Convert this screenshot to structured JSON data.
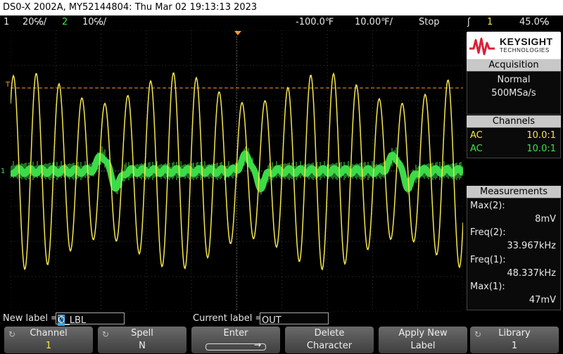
{
  "title": "DS0-X 2002A, MY52144804: Thu Mar 02 19:13:13 2023",
  "status": {
    "ch1_num": "1",
    "ch1_scale": "20℅/",
    "ch2_num": "2",
    "ch2_scale": "10℅/",
    "time_delay": "-100.0℉",
    "time_scale": "10.00℉/",
    "run_state": "Stop",
    "trigger_symbol": "ʃ",
    "trigger_source": "1",
    "trigger_level": "45.0℅"
  },
  "screen": {
    "trigger_marker": "T",
    "ground_marker": "1"
  },
  "colors": {
    "ch1": "#f5e64a",
    "ch2": "#3ee04a",
    "trigger": "#ff9a2a",
    "grid": "#3a3a3a",
    "logo_wave": "#d6223a"
  },
  "logo": {
    "brand": "KEYSIGHT",
    "sub": "TECHNOLOGIES"
  },
  "acquisition": {
    "header": "Acquisition",
    "mode": "Normal",
    "rate": "500MSa/s"
  },
  "channels": {
    "header": "Channels",
    "rows": [
      {
        "coupling": "AC",
        "probe": "10.0:1"
      },
      {
        "coupling": "AC",
        "probe": "10.0:1"
      }
    ]
  },
  "measurements": {
    "header": "Measurements",
    "items": [
      {
        "label": "Max(2):",
        "value": "8mV"
      },
      {
        "label": "Freq(2):",
        "value": "33.967kHz"
      },
      {
        "label": "Freq(1):",
        "value": "48.337kHz"
      },
      {
        "label": "Max(1):",
        "value": "47mV"
      }
    ]
  },
  "label_bar": {
    "new_label_prefix": "New label =",
    "new_label_cursor": "N",
    "new_label_rest": "O_LBL",
    "current_label_prefix": "Current label =",
    "current_label_value": "OUT"
  },
  "softkeys": [
    {
      "l1": "Channel",
      "l2": "1"
    },
    {
      "l1": "Spell",
      "l2": "N"
    },
    {
      "l1": "Enter",
      "l2": ""
    },
    {
      "l1": "Delete",
      "l2": "Character"
    },
    {
      "l1": "Apply New",
      "l2": "Label"
    },
    {
      "l1": "Library",
      "l2": "1"
    }
  ]
}
